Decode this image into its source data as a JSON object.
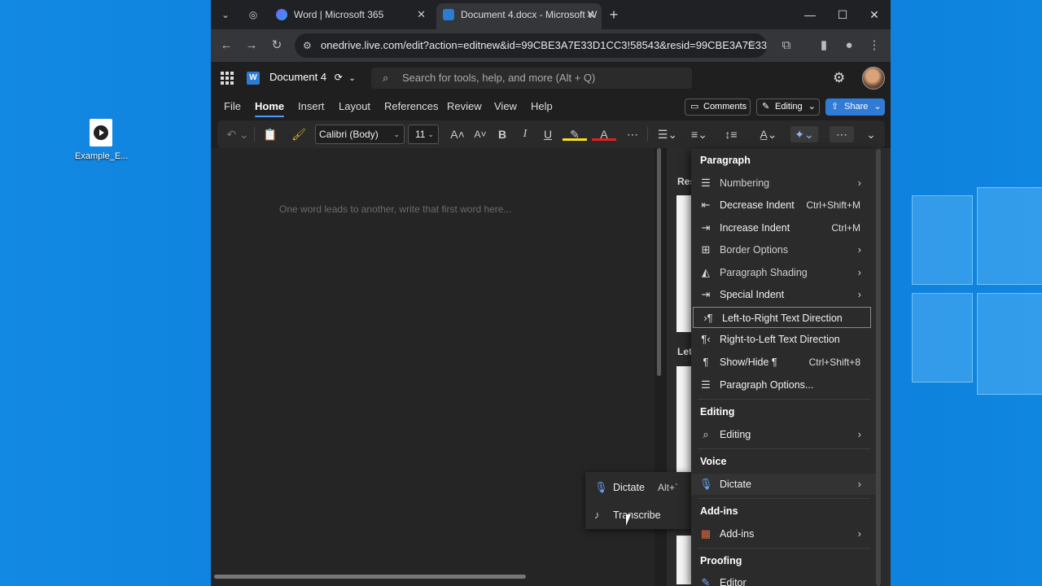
{
  "desktop": {
    "icon_label": "Example_E..."
  },
  "browser": {
    "tabs": [
      {
        "title": "Word | Microsoft 365"
      },
      {
        "title": "Document 4.docx - Microsoft W"
      }
    ],
    "url": "onedrive.live.com/edit?action=editnew&id=99CBE3A7E33D1CC3!58543&resid=99CBE3A7E33D..."
  },
  "word": {
    "doc_name": "Document 4",
    "search_placeholder": "Search for tools, help, and more (Alt + Q)",
    "menu": [
      "File",
      "Home",
      "Insert",
      "Layout",
      "References",
      "Review",
      "View",
      "Help"
    ],
    "active_menu": "Home",
    "comments_label": "Comments",
    "editing_label": "Editing",
    "share_label": "Share",
    "font_name": "Calibri (Body)",
    "font_size": "11",
    "placeholder": "One word leads to another, write that first word here...",
    "side_headers": [
      "Res",
      "Let"
    ]
  },
  "dictate_popup": {
    "dictate_label": "Dictate",
    "dictate_shortcut": "Alt+`",
    "transcribe_label": "Transcribe"
  },
  "overflow_menu": {
    "paragraph_header": "Paragraph",
    "numbering": "Numbering",
    "decrease_indent": "Decrease Indent",
    "decrease_indent_shortcut": "Ctrl+Shift+M",
    "increase_indent": "Increase Indent",
    "increase_indent_shortcut": "Ctrl+M",
    "border_options": "Border Options",
    "paragraph_shading": "Paragraph Shading",
    "special_indent": "Special Indent",
    "ltr": "Left-to-Right Text Direction",
    "rtl": "Right-to-Left Text Direction",
    "show_hide": "Show/Hide ¶",
    "show_hide_shortcut": "Ctrl+Shift+8",
    "paragraph_options": "Paragraph Options...",
    "editing_header": "Editing",
    "editing": "Editing",
    "voice_header": "Voice",
    "dictate": "Dictate",
    "addins_header": "Add-ins",
    "addins": "Add-ins",
    "proofing_header": "Proofing",
    "editor": "Editor"
  },
  "colors": {
    "accent": "#2f7bd5",
    "desktop": "#0b7bd9",
    "word_icon": "#2b7cd3"
  }
}
